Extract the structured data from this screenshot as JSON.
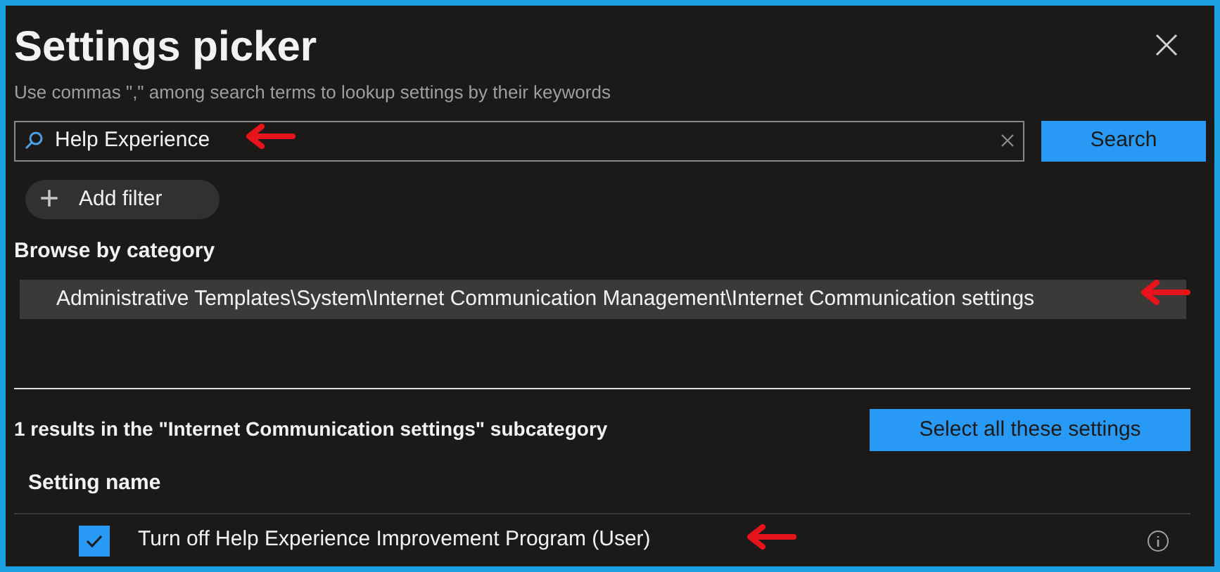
{
  "panel": {
    "title": "Settings picker",
    "subtitle": "Use commas \",\" among search terms to lookup settings by their keywords"
  },
  "search": {
    "value": "Help Experience",
    "button": "Search"
  },
  "add_filter": {
    "label": "Add filter",
    "icon": "+"
  },
  "browse": {
    "label": "Browse by category",
    "category_path": "Administrative Templates\\System\\Internet Communication Management\\Internet Communication settings"
  },
  "results": {
    "summary": "1 results in the \"Internet Communication settings\" subcategory",
    "select_all_button": "Select all these settings",
    "column": "Setting name",
    "rows": [
      {
        "name": "Turn off Help Experience Improvement Program (User)",
        "checked": true
      }
    ]
  }
}
